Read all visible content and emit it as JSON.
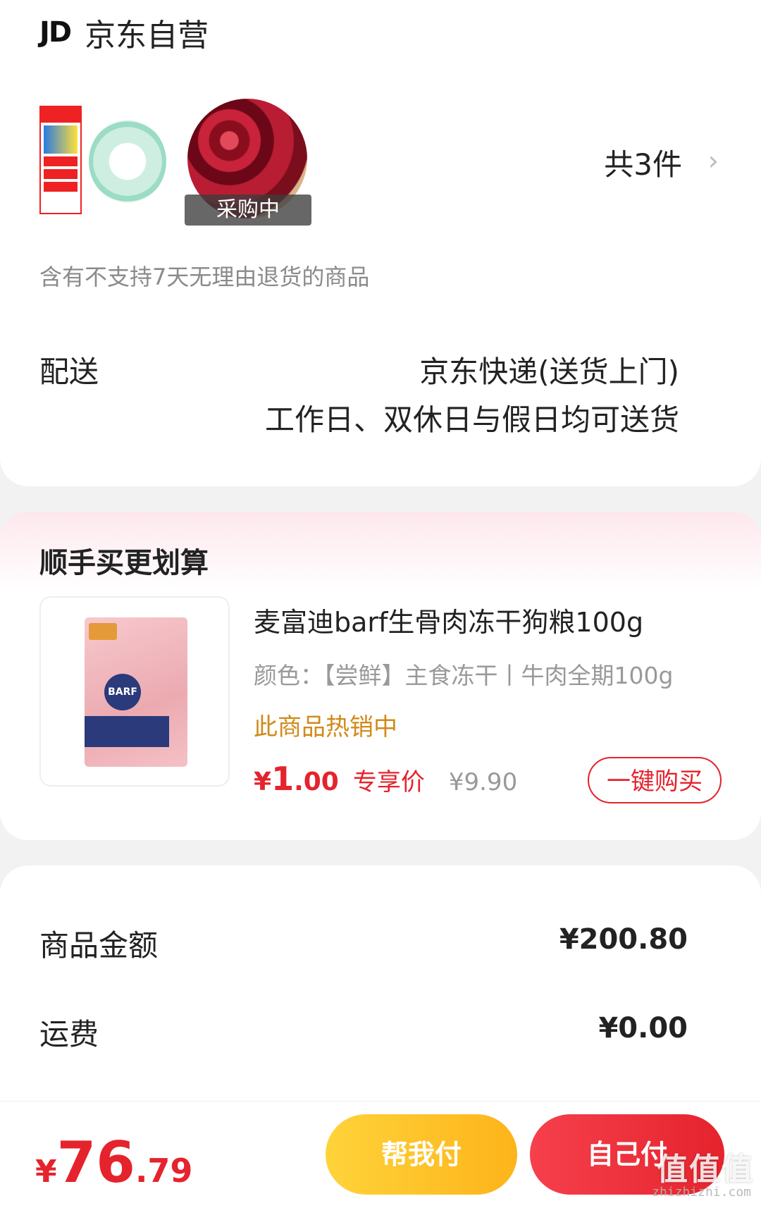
{
  "store": {
    "logo_text": "JD",
    "name": "京东自营",
    "thumb_badge": "采购中",
    "count_text": "共3件",
    "chevron": "›",
    "no_return_note": "含有不支持7天无理由退货的商品"
  },
  "delivery": {
    "label": "配送",
    "method": "京东快递(送货上门)",
    "note": "工作日、双休日与假日均可送货"
  },
  "upsell": {
    "title": "顺手买更划算",
    "product": {
      "name": "麦富迪barf生骨肉冻干狗粮100g",
      "spec": "颜色：【尝鲜】主食冻干丨牛肉全期100g",
      "hot": "此商品热销中",
      "price_symbol": "¥",
      "price_int": "1",
      "price_dec": ".00",
      "price_tag": "专享价",
      "old_price": "¥9.90",
      "buy_label": "一键购买",
      "bag_label": "BARF"
    }
  },
  "summary": {
    "items_label": "商品金额",
    "items_value": "¥200.80",
    "shipping_label": "运费",
    "shipping_value": "¥0.00"
  },
  "bottom": {
    "symbol": "¥",
    "total_int": "76",
    "total_dec": ".79",
    "help_pay": "帮我付",
    "self_pay": "自己付",
    "watermark": "值值值",
    "watermark_url": "zhizhizhi.com"
  },
  "colors": {
    "accent_red": "#e5232d",
    "hot_orange": "#d08a1a",
    "help_yellow": "#fdb41a"
  }
}
